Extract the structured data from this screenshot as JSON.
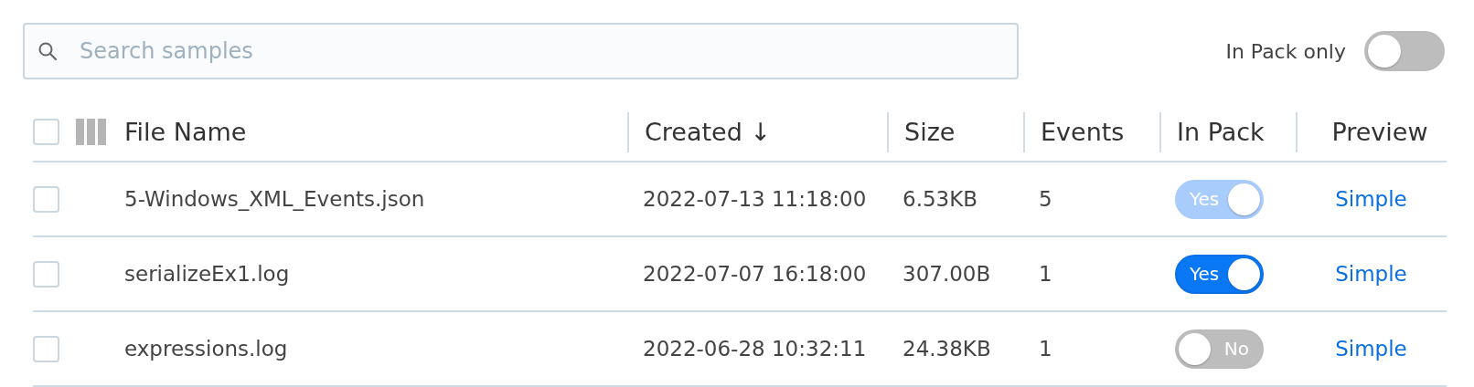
{
  "search": {
    "placeholder": "Search samples"
  },
  "filter": {
    "label": "In Pack only",
    "on": false
  },
  "table": {
    "select_all": {
      "checked": false
    },
    "columns": [
      {
        "label": "File Name",
        "kind": "name"
      },
      {
        "label": "Created ↓",
        "kind": "text"
      },
      {
        "label": "Size",
        "kind": "text"
      },
      {
        "label": "Events",
        "kind": "text"
      },
      {
        "label": "In Pack",
        "kind": "text"
      },
      {
        "label": "Preview",
        "kind": "center"
      }
    ],
    "rows": [
      {
        "checked": false,
        "file_name": "5-Windows_XML_Events.json",
        "created": "2022-07-13 11:18:00",
        "size": "6.53KB",
        "events": "5",
        "in_pack": {
          "label": "Yes",
          "on": true,
          "disabled": true
        },
        "preview": "Simple"
      },
      {
        "checked": false,
        "file_name": "serializeEx1.log",
        "created": "2022-07-07 16:18:00",
        "size": "307.00B",
        "events": "1",
        "in_pack": {
          "label": "Yes",
          "on": true,
          "disabled": false
        },
        "preview": "Simple"
      },
      {
        "checked": false,
        "file_name": "expressions.log",
        "created": "2022-06-28 10:32:11",
        "size": "24.38KB",
        "events": "1",
        "in_pack": {
          "label": "No",
          "on": false,
          "disabled": false
        },
        "preview": "Simple"
      }
    ]
  }
}
